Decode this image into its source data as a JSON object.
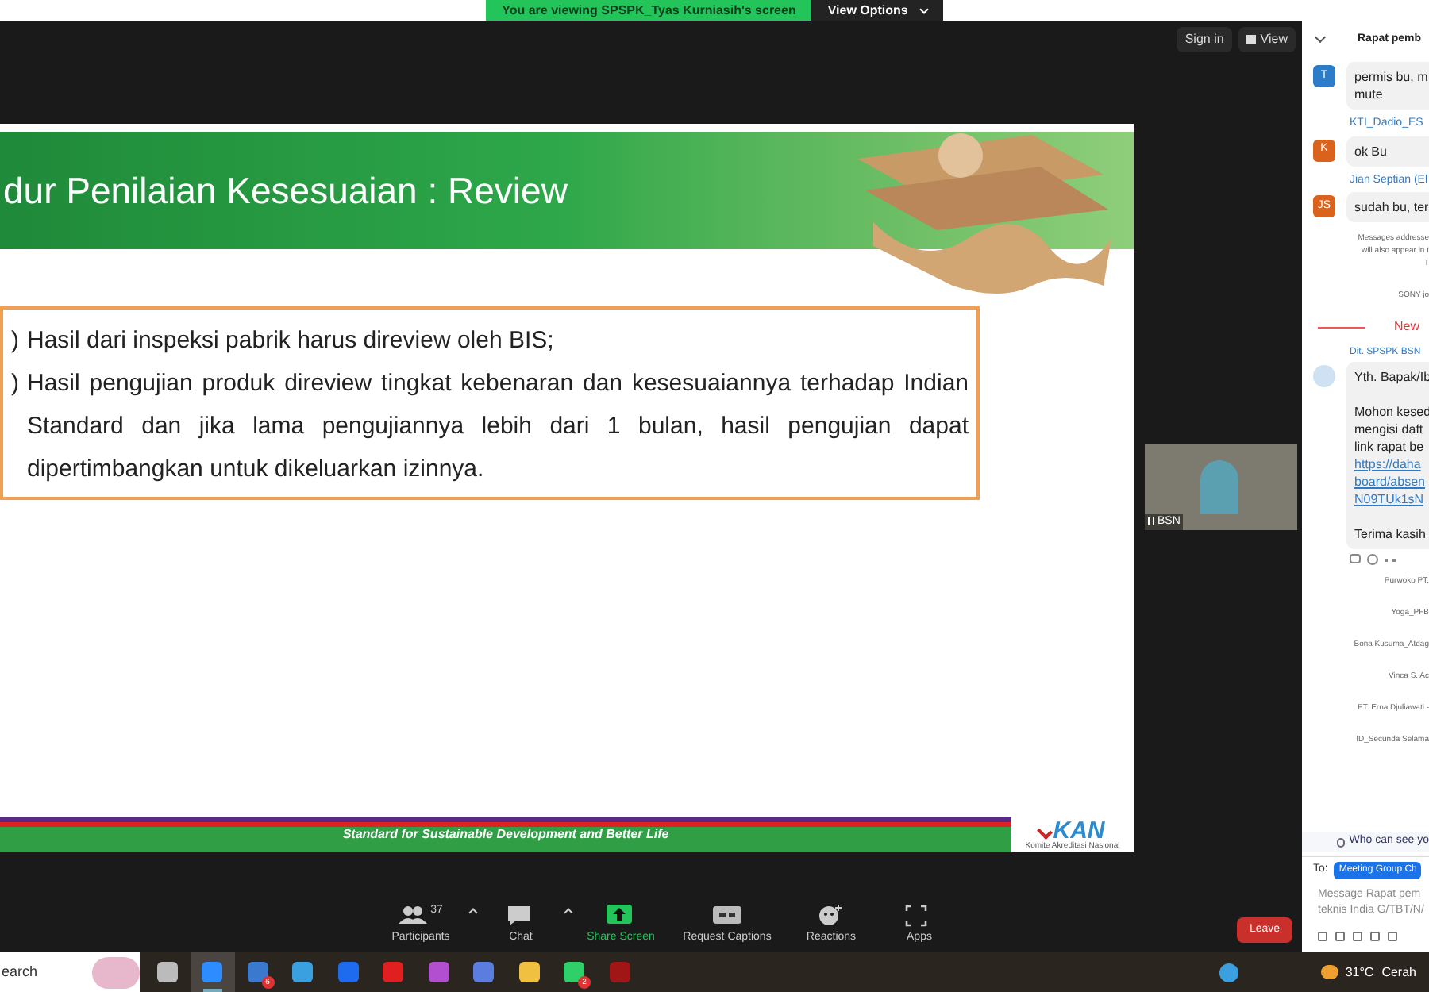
{
  "banner": {
    "text": "You are viewing SPSPK_Tyas Kurniasih's screen",
    "button": "View Options"
  },
  "top_controls": {
    "sign_in": "Sign in",
    "view": "View"
  },
  "slide": {
    "title": "dur Penilaian Kesesuaian : Review",
    "items": [
      {
        "marker": ")",
        "text": "Hasil dari inspeksi pabrik harus direview oleh BIS;"
      },
      {
        "marker": ")",
        "text": "Hasil pengujian produk direview tingkat kebenaran dan kesesuaiannya terhadap Indian Standard dan jika lama pengujiannya lebih dari 1 bulan, hasil pengujian dapat dipertimbangkan untuk dikeluarkan izinnya."
      }
    ],
    "footer": "Standard for Sustainable Development and Better Life",
    "logo": "KAN",
    "logo_sub": "Komite Akreditasi Nasional"
  },
  "video_tile": {
    "name": "BSN"
  },
  "toolbar": [
    {
      "label": "Participants",
      "count": "37",
      "kind": "participants",
      "caret": true
    },
    {
      "label": "Chat",
      "kind": "chat",
      "caret": true
    },
    {
      "label": "Share Screen",
      "kind": "share",
      "caret": false
    },
    {
      "label": "Request Captions",
      "kind": "captions",
      "caret": false
    },
    {
      "label": "Reactions",
      "kind": "reactions",
      "caret": false
    },
    {
      "label": "Apps",
      "kind": "apps",
      "caret": false
    }
  ],
  "leave": "Leave",
  "chat": {
    "title": "Rapat pemb",
    "messages": [
      {
        "kind": "message",
        "avatar": "T",
        "color": "#2d7cc9",
        "lines": [
          "permis bu, m",
          "mute"
        ]
      },
      {
        "kind": "message",
        "sender": "KTI_Dadio_ES",
        "avatar": "K",
        "color": "#d9621c",
        "lines": [
          "ok Bu"
        ]
      },
      {
        "kind": "message",
        "sender": "Jian Septian (El",
        "avatar": "JS",
        "color": "#d9621c",
        "lines": [
          "sudah bu, ter"
        ]
      },
      {
        "kind": "notice",
        "lines": [
          "Messages addresse",
          "will also appear in t",
          "T"
        ]
      },
      {
        "kind": "notice",
        "lines": [
          "SONY jo"
        ]
      },
      {
        "kind": "divider",
        "lines": [
          "New"
        ]
      },
      {
        "kind": "rich",
        "sender": "Dit. SPSPK BSN",
        "greeting": "Yth. Bapak/Ib",
        "lines": [
          "Mohon kesed",
          "mengisi daft",
          "link rapat be"
        ],
        "links": [
          "https://daha",
          "board/absen",
          "N09TUk1sN"
        ],
        "after": [
          "Terima kasih"
        ]
      },
      {
        "kind": "notice",
        "lines": [
          "Purwoko PT."
        ]
      },
      {
        "kind": "notice",
        "lines": [
          "Yoga_PFB"
        ]
      },
      {
        "kind": "notice",
        "lines": [
          "Bona Kusuma_Atdag"
        ]
      },
      {
        "kind": "notice",
        "lines": [
          "Vinca S. Ac"
        ]
      },
      {
        "kind": "notice",
        "lines": [
          "PT. Erna Djuliawati -"
        ]
      },
      {
        "kind": "notice",
        "lines": [
          "ID_Secunda Selama"
        ]
      }
    ],
    "who": "Who can see yo",
    "to": "To:",
    "recipient": "Meeting Group Ch",
    "placeholder": "Message Rapat pem\nteknis India G/TBT/N/"
  },
  "taskbar": {
    "search": "earch",
    "apps": [
      {
        "kind": "taskview",
        "selected": false
      },
      {
        "kind": "zoom",
        "selected": true
      },
      {
        "kind": "chrome",
        "selected": false,
        "badge": "6"
      },
      {
        "kind": "vs",
        "selected": false
      },
      {
        "kind": "dropbox",
        "selected": false
      },
      {
        "kind": "opera",
        "selected": false
      },
      {
        "kind": "office",
        "selected": false
      },
      {
        "kind": "edge",
        "selected": false
      },
      {
        "kind": "files",
        "selected": false
      },
      {
        "kind": "whatsapp",
        "selected": false,
        "badge": "2"
      },
      {
        "kind": "bug",
        "selected": false
      }
    ],
    "temperature": "31°C",
    "weather": "Cerah"
  }
}
